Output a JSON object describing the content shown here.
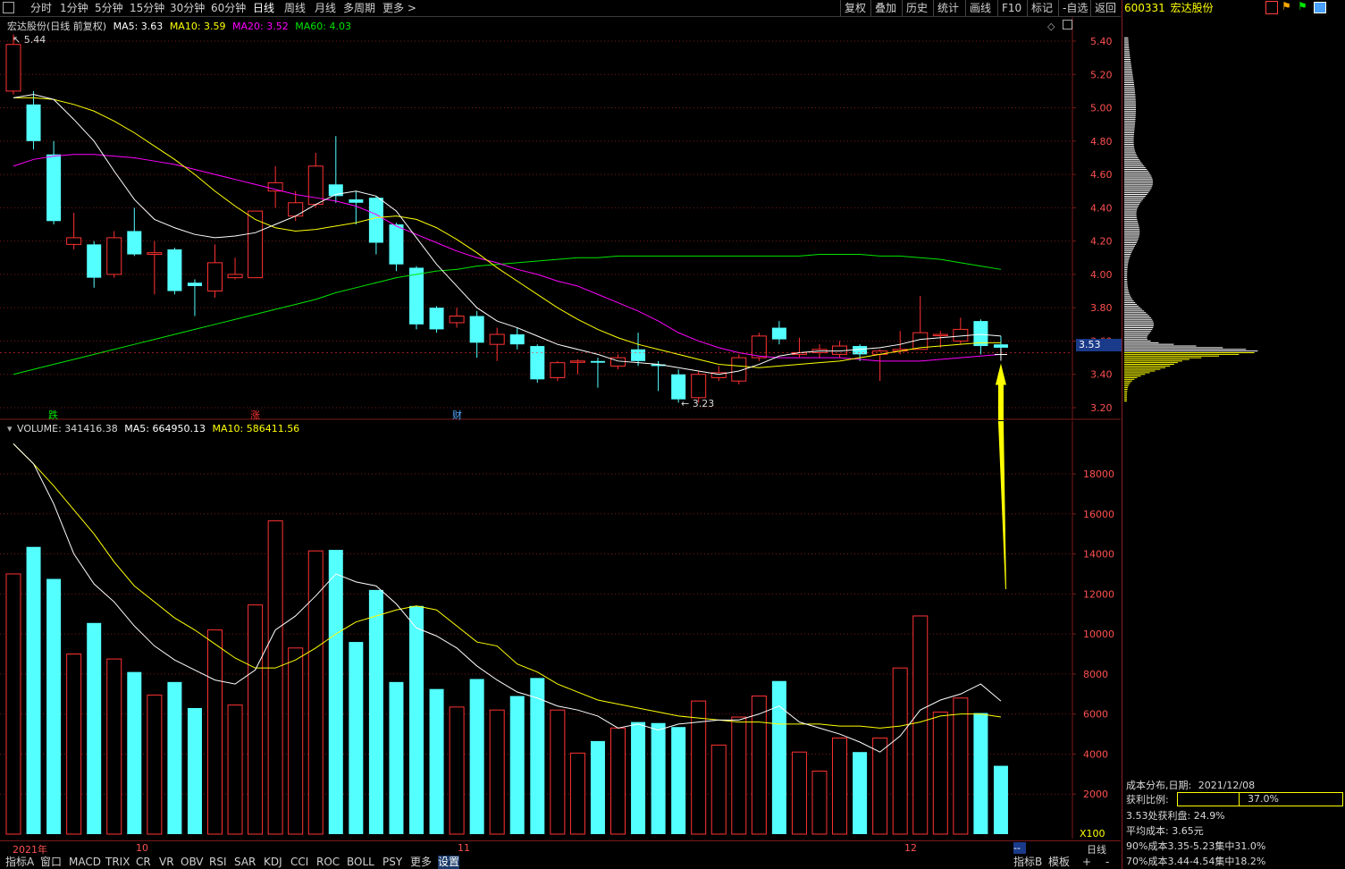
{
  "toolbar": {
    "periods": [
      "分时",
      "1分钟",
      "5分钟",
      "15分钟",
      "30分钟",
      "60分钟",
      "日线",
      "周线",
      "月线",
      "多周期",
      "更多 >"
    ],
    "active_period": "日线",
    "right_buttons": [
      "复权",
      "叠加",
      "历史",
      "统计",
      "画线",
      "F10",
      "标记",
      "-自选",
      "返回"
    ]
  },
  "stock": {
    "code": "600331",
    "name": "宏达股份"
  },
  "main_info": {
    "title": "宏达股份(日线 前复权)",
    "ma5": "MA5: 3.63",
    "ma10": "MA10: 3.59",
    "ma20": "MA20: 3.52",
    "ma60": "MA60: 4.03",
    "high_label": "5.44",
    "low_label": "3.23",
    "markers": [
      "跌",
      "涨",
      "财"
    ],
    "current_price": "3.53"
  },
  "price_axis": [
    "5.40",
    "5.20",
    "5.00",
    "4.80",
    "4.60",
    "4.40",
    "4.20",
    "4.00",
    "3.80",
    "3.60",
    "3.40",
    "3.20"
  ],
  "vol_info": {
    "volume": "VOLUME: 341416.38",
    "ma5": "MA5: 664950.13",
    "ma10": "MA10: 586411.56"
  },
  "vol_axis": [
    "18000",
    "16000",
    "14000",
    "12000",
    "10000",
    "8000",
    "6000",
    "4000",
    "2000"
  ],
  "vol_unit": "X100",
  "date_axis": {
    "labels": [
      "2021年",
      "10",
      "11",
      "12"
    ],
    "right": "日线",
    "dash": "--"
  },
  "tabs": [
    "指标A",
    "窗口",
    "MACD",
    "TRIX",
    "CR",
    "VR",
    "OBV",
    "RSI",
    "SAR",
    "KDJ",
    "CCI",
    "ROC",
    "BOLL",
    "PSY",
    "更多",
    "设置"
  ],
  "right_tabs": [
    "指标B",
    "模板",
    "+",
    "-"
  ],
  "cost": {
    "title": "成本分布,日期:",
    "date": "2021/12/08",
    "profit_label": "获利比例:",
    "profit_value": "37.0%",
    "profit_ratio": 0.37,
    "line1": "3.53处获利盘: 24.9%",
    "line2": "平均成本: 3.65元",
    "line3": "90%成本3.35-5.23集中31.0%",
    "line4": "70%成本3.44-4.54集中18.2%"
  },
  "colors": {
    "up": "#ff3232",
    "down": "#54ffff",
    "ma5": "#ffffff",
    "ma10": "#ffff00",
    "ma20": "#ff00ff",
    "ma60": "#00e600",
    "grid": "#7a1a1a",
    "arrow": "#ffff00"
  },
  "chart_data": {
    "type": "candlestick",
    "candles": [
      {
        "o": 5.1,
        "h": 5.44,
        "l": 5.08,
        "c": 5.38,
        "v": 13000
      },
      {
        "o": 5.02,
        "h": 5.1,
        "l": 4.75,
        "c": 4.8,
        "v": 14350
      },
      {
        "o": 4.72,
        "h": 4.8,
        "l": 4.3,
        "c": 4.32,
        "v": 12750
      },
      {
        "o": 4.18,
        "h": 4.37,
        "l": 4.15,
        "c": 4.22,
        "v": 9000
      },
      {
        "o": 4.18,
        "h": 4.2,
        "l": 3.92,
        "c": 3.98,
        "v": 10550
      },
      {
        "o": 4.0,
        "h": 4.26,
        "l": 3.98,
        "c": 4.22,
        "v": 8750
      },
      {
        "o": 4.26,
        "h": 4.4,
        "l": 4.11,
        "c": 4.12,
        "v": 8100
      },
      {
        "o": 4.12,
        "h": 4.2,
        "l": 3.88,
        "c": 4.13,
        "v": 6950
      },
      {
        "o": 4.15,
        "h": 4.16,
        "l": 3.88,
        "c": 3.9,
        "v": 7600
      },
      {
        "o": 3.95,
        "h": 3.97,
        "l": 3.75,
        "c": 3.93,
        "v": 6300
      },
      {
        "o": 3.9,
        "h": 4.18,
        "l": 3.86,
        "c": 4.07,
        "v": 10200
      },
      {
        "o": 3.98,
        "h": 4.1,
        "l": 3.97,
        "c": 4.0,
        "v": 6450
      },
      {
        "o": 3.98,
        "h": 4.38,
        "l": 3.98,
        "c": 4.38,
        "v": 11450
      },
      {
        "o": 4.5,
        "h": 4.65,
        "l": 4.4,
        "c": 4.55,
        "v": 15650
      },
      {
        "o": 4.35,
        "h": 4.5,
        "l": 4.32,
        "c": 4.43,
        "v": 9300
      },
      {
        "o": 4.42,
        "h": 4.73,
        "l": 4.4,
        "c": 4.65,
        "v": 14150
      },
      {
        "o": 4.54,
        "h": 4.83,
        "l": 4.43,
        "c": 4.47,
        "v": 14200
      },
      {
        "o": 4.45,
        "h": 4.5,
        "l": 4.3,
        "c": 4.43,
        "v": 9600
      },
      {
        "o": 4.46,
        "h": 4.47,
        "l": 4.12,
        "c": 4.19,
        "v": 12200
      },
      {
        "o": 4.3,
        "h": 4.31,
        "l": 4.02,
        "c": 4.06,
        "v": 7600
      },
      {
        "o": 4.04,
        "h": 4.05,
        "l": 3.67,
        "c": 3.7,
        "v": 11400
      },
      {
        "o": 3.8,
        "h": 3.81,
        "l": 3.65,
        "c": 3.67,
        "v": 7250
      },
      {
        "o": 3.71,
        "h": 3.8,
        "l": 3.68,
        "c": 3.75,
        "v": 6350
      },
      {
        "o": 3.75,
        "h": 3.78,
        "l": 3.5,
        "c": 3.59,
        "v": 7750
      },
      {
        "o": 3.58,
        "h": 3.68,
        "l": 3.48,
        "c": 3.64,
        "v": 6200
      },
      {
        "o": 3.64,
        "h": 3.68,
        "l": 3.55,
        "c": 3.58,
        "v": 6900
      },
      {
        "o": 3.57,
        "h": 3.58,
        "l": 3.35,
        "c": 3.37,
        "v": 7800
      },
      {
        "o": 3.38,
        "h": 3.48,
        "l": 3.36,
        "c": 3.47,
        "v": 6200
      },
      {
        "o": 3.48,
        "h": 3.49,
        "l": 3.4,
        "c": 3.48,
        "v": 4050
      },
      {
        "o": 3.48,
        "h": 3.5,
        "l": 3.32,
        "c": 3.47,
        "v": 4650
      },
      {
        "o": 3.45,
        "h": 3.52,
        "l": 3.43,
        "c": 3.5,
        "v": 5300
      },
      {
        "o": 3.55,
        "h": 3.65,
        "l": 3.45,
        "c": 3.48,
        "v": 5600
      },
      {
        "o": 3.46,
        "h": 3.48,
        "l": 3.3,
        "c": 3.45,
        "v": 5550
      },
      {
        "o": 3.4,
        "h": 3.43,
        "l": 3.23,
        "c": 3.25,
        "v": 5350
      },
      {
        "o": 3.26,
        "h": 3.42,
        "l": 3.23,
        "c": 3.4,
        "v": 6650
      },
      {
        "o": 3.38,
        "h": 3.45,
        "l": 3.36,
        "c": 3.41,
        "v": 4450
      },
      {
        "o": 3.36,
        "h": 3.52,
        "l": 3.34,
        "c": 3.5,
        "v": 5850
      },
      {
        "o": 3.5,
        "h": 3.65,
        "l": 3.48,
        "c": 3.63,
        "v": 6900
      },
      {
        "o": 3.68,
        "h": 3.72,
        "l": 3.58,
        "c": 3.61,
        "v": 7650
      },
      {
        "o": 3.52,
        "h": 3.62,
        "l": 3.5,
        "c": 3.53,
        "v": 4100
      },
      {
        "o": 3.53,
        "h": 3.58,
        "l": 3.5,
        "c": 3.55,
        "v": 3150
      },
      {
        "o": 3.52,
        "h": 3.6,
        "l": 3.5,
        "c": 3.57,
        "v": 4800
      },
      {
        "o": 3.57,
        "h": 3.58,
        "l": 3.48,
        "c": 3.52,
        "v": 4100
      },
      {
        "o": 3.52,
        "h": 3.55,
        "l": 3.36,
        "c": 3.54,
        "v": 4800
      },
      {
        "o": 3.54,
        "h": 3.66,
        "l": 3.52,
        "c": 3.55,
        "v": 8300
      },
      {
        "o": 3.55,
        "h": 3.87,
        "l": 3.55,
        "c": 3.65,
        "v": 10900
      },
      {
        "o": 3.64,
        "h": 3.66,
        "l": 3.56,
        "c": 3.64,
        "v": 6100
      },
      {
        "o": 3.6,
        "h": 3.74,
        "l": 3.58,
        "c": 3.67,
        "v": 6800
      },
      {
        "o": 3.72,
        "h": 3.73,
        "l": 3.52,
        "c": 3.57,
        "v": 6050
      },
      {
        "o": 3.58,
        "h": 3.63,
        "l": 3.54,
        "c": 3.56,
        "v": 3414
      }
    ],
    "ma5": [
      5.06,
      5.08,
      5.05,
      4.93,
      4.8,
      4.62,
      4.45,
      4.33,
      4.28,
      4.24,
      4.22,
      4.23,
      4.25,
      4.3,
      4.35,
      4.42,
      4.48,
      4.5,
      4.47,
      4.38,
      4.22,
      4.06,
      3.93,
      3.8,
      3.72,
      3.68,
      3.63,
      3.58,
      3.55,
      3.52,
      3.48,
      3.47,
      3.46,
      3.44,
      3.42,
      3.4,
      3.42,
      3.46,
      3.51,
      3.53,
      3.54,
      3.54,
      3.55,
      3.56,
      3.58,
      3.61,
      3.62,
      3.63,
      3.64,
      3.63
    ],
    "ma10": [
      5.06,
      5.06,
      5.05,
      5.02,
      4.98,
      4.92,
      4.85,
      4.77,
      4.69,
      4.6,
      4.5,
      4.41,
      4.33,
      4.28,
      4.26,
      4.27,
      4.29,
      4.31,
      4.34,
      4.35,
      4.33,
      4.28,
      4.21,
      4.13,
      4.04,
      3.96,
      3.88,
      3.8,
      3.73,
      3.67,
      3.62,
      3.58,
      3.55,
      3.52,
      3.49,
      3.46,
      3.45,
      3.44,
      3.45,
      3.46,
      3.47,
      3.48,
      3.5,
      3.52,
      3.54,
      3.56,
      3.57,
      3.58,
      3.59,
      3.59
    ],
    "ma20": [
      4.65,
      4.69,
      4.71,
      4.72,
      4.72,
      4.71,
      4.7,
      4.68,
      4.66,
      4.63,
      4.6,
      4.57,
      4.54,
      4.51,
      4.48,
      4.46,
      4.44,
      4.41,
      4.36,
      4.29,
      4.24,
      4.19,
      4.14,
      4.1,
      4.07,
      4.03,
      4.0,
      3.96,
      3.93,
      3.88,
      3.83,
      3.78,
      3.72,
      3.65,
      3.6,
      3.56,
      3.53,
      3.51,
      3.5,
      3.5,
      3.5,
      3.5,
      3.49,
      3.48,
      3.48,
      3.48,
      3.49,
      3.5,
      3.51,
      3.52
    ],
    "ma60": [
      3.4,
      3.43,
      3.46,
      3.49,
      3.52,
      3.55,
      3.58,
      3.61,
      3.64,
      3.67,
      3.7,
      3.73,
      3.76,
      3.79,
      3.82,
      3.85,
      3.89,
      3.92,
      3.95,
      3.98,
      4.0,
      4.02,
      4.03,
      4.05,
      4.06,
      4.07,
      4.08,
      4.09,
      4.1,
      4.1,
      4.11,
      4.11,
      4.11,
      4.11,
      4.11,
      4.11,
      4.11,
      4.11,
      4.11,
      4.11,
      4.12,
      4.12,
      4.12,
      4.11,
      4.11,
      4.1,
      4.09,
      4.07,
      4.05,
      4.03
    ],
    "vol_ma5": [
      19500,
      18500,
      16500,
      14000,
      12500,
      11600,
      10400,
      9400,
      8700,
      8200,
      7700,
      7500,
      8200,
      10200,
      10900,
      11900,
      13000,
      12600,
      12400,
      11500,
      10300,
      9900,
      9300,
      8400,
      7700,
      7100,
      6800,
      6400,
      6200,
      5900,
      5300,
      5500,
      5200,
      5500,
      5600,
      5700,
      5700,
      6000,
      6400,
      5600,
      5300,
      5000,
      4600,
      4100,
      4900,
      6200,
      6700,
      7000,
      7500,
      6650
    ],
    "vol_ma10": [
      19500,
      18500,
      17400,
      16200,
      15000,
      13600,
      12400,
      11600,
      10800,
      10200,
      9500,
      8800,
      8300,
      8300,
      8700,
      9300,
      10000,
      10600,
      10900,
      11200,
      11400,
      11200,
      10400,
      9600,
      9400,
      8500,
      8100,
      7500,
      7100,
      6700,
      6500,
      6300,
      6100,
      5900,
      5800,
      5700,
      5600,
      5600,
      5500,
      5500,
      5500,
      5400,
      5400,
      5300,
      5400,
      5600,
      5900,
      6000,
      6000,
      5850
    ]
  }
}
